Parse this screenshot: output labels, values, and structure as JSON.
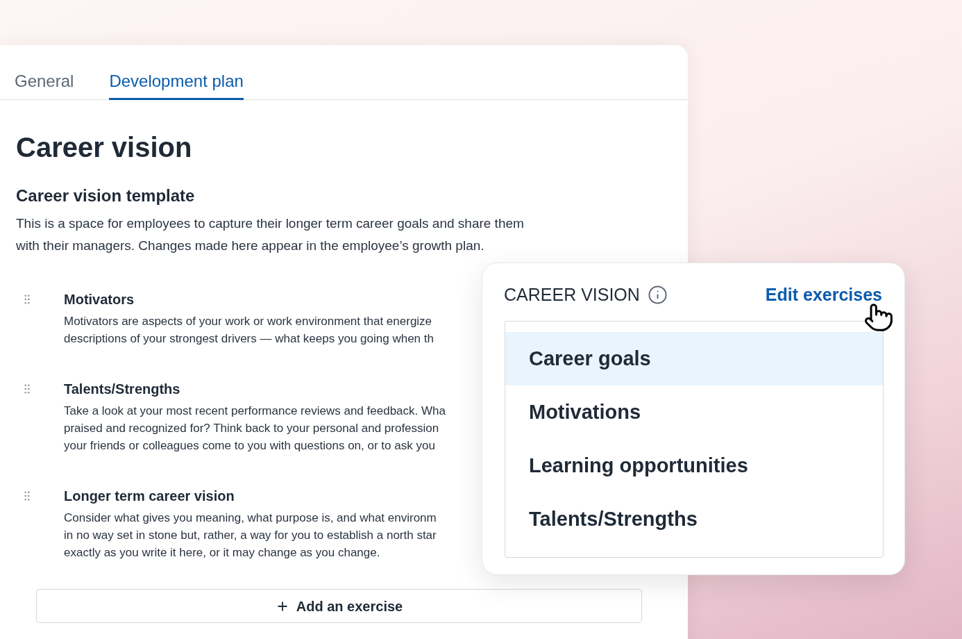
{
  "tabs": [
    {
      "label": "General",
      "selected": false
    },
    {
      "label": "Development plan",
      "selected": true
    }
  ],
  "page_title": "Career vision",
  "template": {
    "title": "Career vision template",
    "description": "This is a space for employees to capture their longer term career goals and share them with their managers. Changes made here appear in the employee’s growth plan."
  },
  "exercises": [
    {
      "title": "Motivators",
      "description_lines": [
        "Motivators are aspects of your work or work environment that energize",
        "descriptions of your strongest drivers — what keeps you going when th"
      ]
    },
    {
      "title": "Talents/Strengths",
      "description_lines": [
        "Take a look at your most recent performance reviews and feedback. Wha",
        "praised and recognized for? Think back to your personal and profession",
        "your friends or colleagues come to you with questions on, or to ask you"
      ]
    },
    {
      "title": "Longer term career vision",
      "description_lines": [
        "Consider what gives you meaning, what purpose is, and what environm",
        "in no way set in stone but, rather, a way for you to establish a north star",
        "exactly as you write it here, or it may change as you change."
      ]
    }
  ],
  "add_button": {
    "label": "Add an exercise"
  },
  "popover": {
    "title": "CAREER VISION",
    "link": "Edit exercises",
    "items": [
      {
        "label": "Career goals",
        "selected": true
      },
      {
        "label": "Motivations",
        "selected": false
      },
      {
        "label": "Learning opportunities",
        "selected": false
      },
      {
        "label": "Talents/Strengths",
        "selected": false
      }
    ]
  }
}
